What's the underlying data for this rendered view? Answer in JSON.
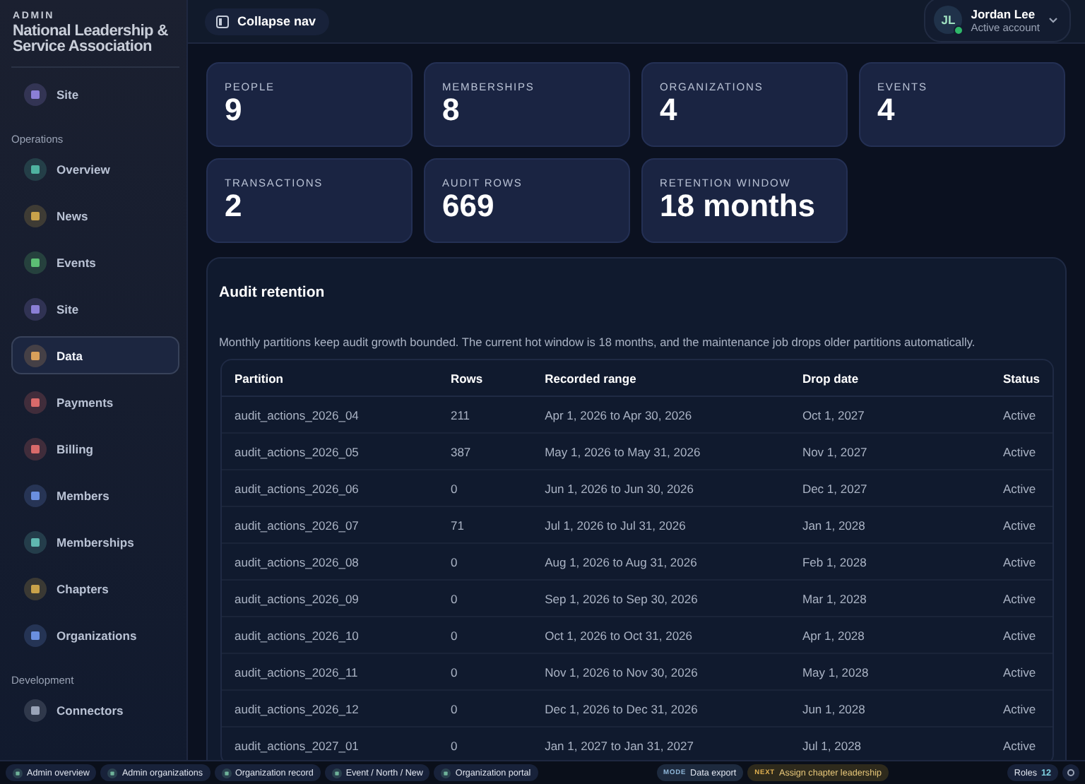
{
  "sidebar": {
    "eyebrow": "ADMIN",
    "title": "National Leadership & Service Association",
    "top_items": [
      {
        "label": "Site",
        "selected": false,
        "color": "#8b7fd6"
      }
    ],
    "sections": [
      {
        "heading": "Operations",
        "items": [
          {
            "label": "Overview",
            "selected": false,
            "color": "#4fb3a0"
          },
          {
            "label": "News",
            "selected": false,
            "color": "#c9a24a"
          },
          {
            "label": "Events",
            "selected": false,
            "color": "#5cbf74"
          },
          {
            "label": "Site",
            "selected": false,
            "color": "#8b7fd6"
          },
          {
            "label": "Data",
            "selected": true,
            "color": "#d9a05a"
          },
          {
            "label": "Payments",
            "selected": false,
            "color": "#d96a6a"
          },
          {
            "label": "Billing",
            "selected": false,
            "color": "#d96a6a"
          },
          {
            "label": "Members",
            "selected": false,
            "color": "#6a8fe0"
          },
          {
            "label": "Memberships",
            "selected": false,
            "color": "#5fb8b0"
          },
          {
            "label": "Chapters",
            "selected": false,
            "color": "#c9a24a"
          },
          {
            "label": "Organizations",
            "selected": false,
            "color": "#6a8fe0"
          }
        ]
      },
      {
        "heading": "Development",
        "items": [
          {
            "label": "Connectors",
            "selected": false,
            "color": "#9aa4b8"
          }
        ]
      }
    ]
  },
  "topbar": {
    "collapse_button": "Collapse nav",
    "user": {
      "initials": "JL",
      "name": "Jordan Lee",
      "status": "Active account",
      "online": true
    }
  },
  "stats": [
    {
      "label": "PEOPLE",
      "value": "9"
    },
    {
      "label": "MEMBERSHIPS",
      "value": "8"
    },
    {
      "label": "ORGANIZATIONS",
      "value": "4"
    },
    {
      "label": "EVENTS",
      "value": "4"
    },
    {
      "label": "TRANSACTIONS",
      "value": "2"
    },
    {
      "label": "AUDIT ROWS",
      "value": "669"
    },
    {
      "label": "RETENTION WINDOW",
      "value": "18 months"
    }
  ],
  "retention": {
    "title": "Audit retention",
    "description": "Monthly partitions keep audit growth bounded. The current hot window is 18 months, and the maintenance job drops older partitions automatically.",
    "table": {
      "columns": [
        "Partition",
        "Rows",
        "Recorded range",
        "Drop date",
        "Status"
      ],
      "rows": [
        [
          "audit_actions_2026_04",
          "211",
          "Apr 1, 2026 to Apr 30, 2026",
          "Oct 1, 2027",
          "Active"
        ],
        [
          "audit_actions_2026_05",
          "387",
          "May 1, 2026 to May 31, 2026",
          "Nov 1, 2027",
          "Active"
        ],
        [
          "audit_actions_2026_06",
          "0",
          "Jun 1, 2026 to Jun 30, 2026",
          "Dec 1, 2027",
          "Active"
        ],
        [
          "audit_actions_2026_07",
          "71",
          "Jul 1, 2026 to Jul 31, 2026",
          "Jan 1, 2028",
          "Active"
        ],
        [
          "audit_actions_2026_08",
          "0",
          "Aug 1, 2026 to Aug 31, 2026",
          "Feb 1, 2028",
          "Active"
        ],
        [
          "audit_actions_2026_09",
          "0",
          "Sep 1, 2026 to Sep 30, 2026",
          "Mar 1, 2028",
          "Active"
        ],
        [
          "audit_actions_2026_10",
          "0",
          "Oct 1, 2026 to Oct 31, 2026",
          "Apr 1, 2028",
          "Active"
        ],
        [
          "audit_actions_2026_11",
          "0",
          "Nov 1, 2026 to Nov 30, 2026",
          "May 1, 2028",
          "Active"
        ],
        [
          "audit_actions_2026_12",
          "0",
          "Dec 1, 2026 to Dec 31, 2026",
          "Jun 1, 2028",
          "Active"
        ],
        [
          "audit_actions_2027_01",
          "0",
          "Jan 1, 2027 to Jan 31, 2027",
          "Jul 1, 2028",
          "Active"
        ]
      ]
    }
  },
  "dev_bar": {
    "links": [
      "Admin overview",
      "Admin organizations",
      "Organization record",
      "Event / North / New",
      "Organization portal"
    ],
    "mode": {
      "tag": "MODE",
      "label": "Data export"
    },
    "next": {
      "tag": "NEXT",
      "label": "Assign chapter leadership"
    },
    "roles": {
      "label": "Roles",
      "count": "12"
    }
  }
}
